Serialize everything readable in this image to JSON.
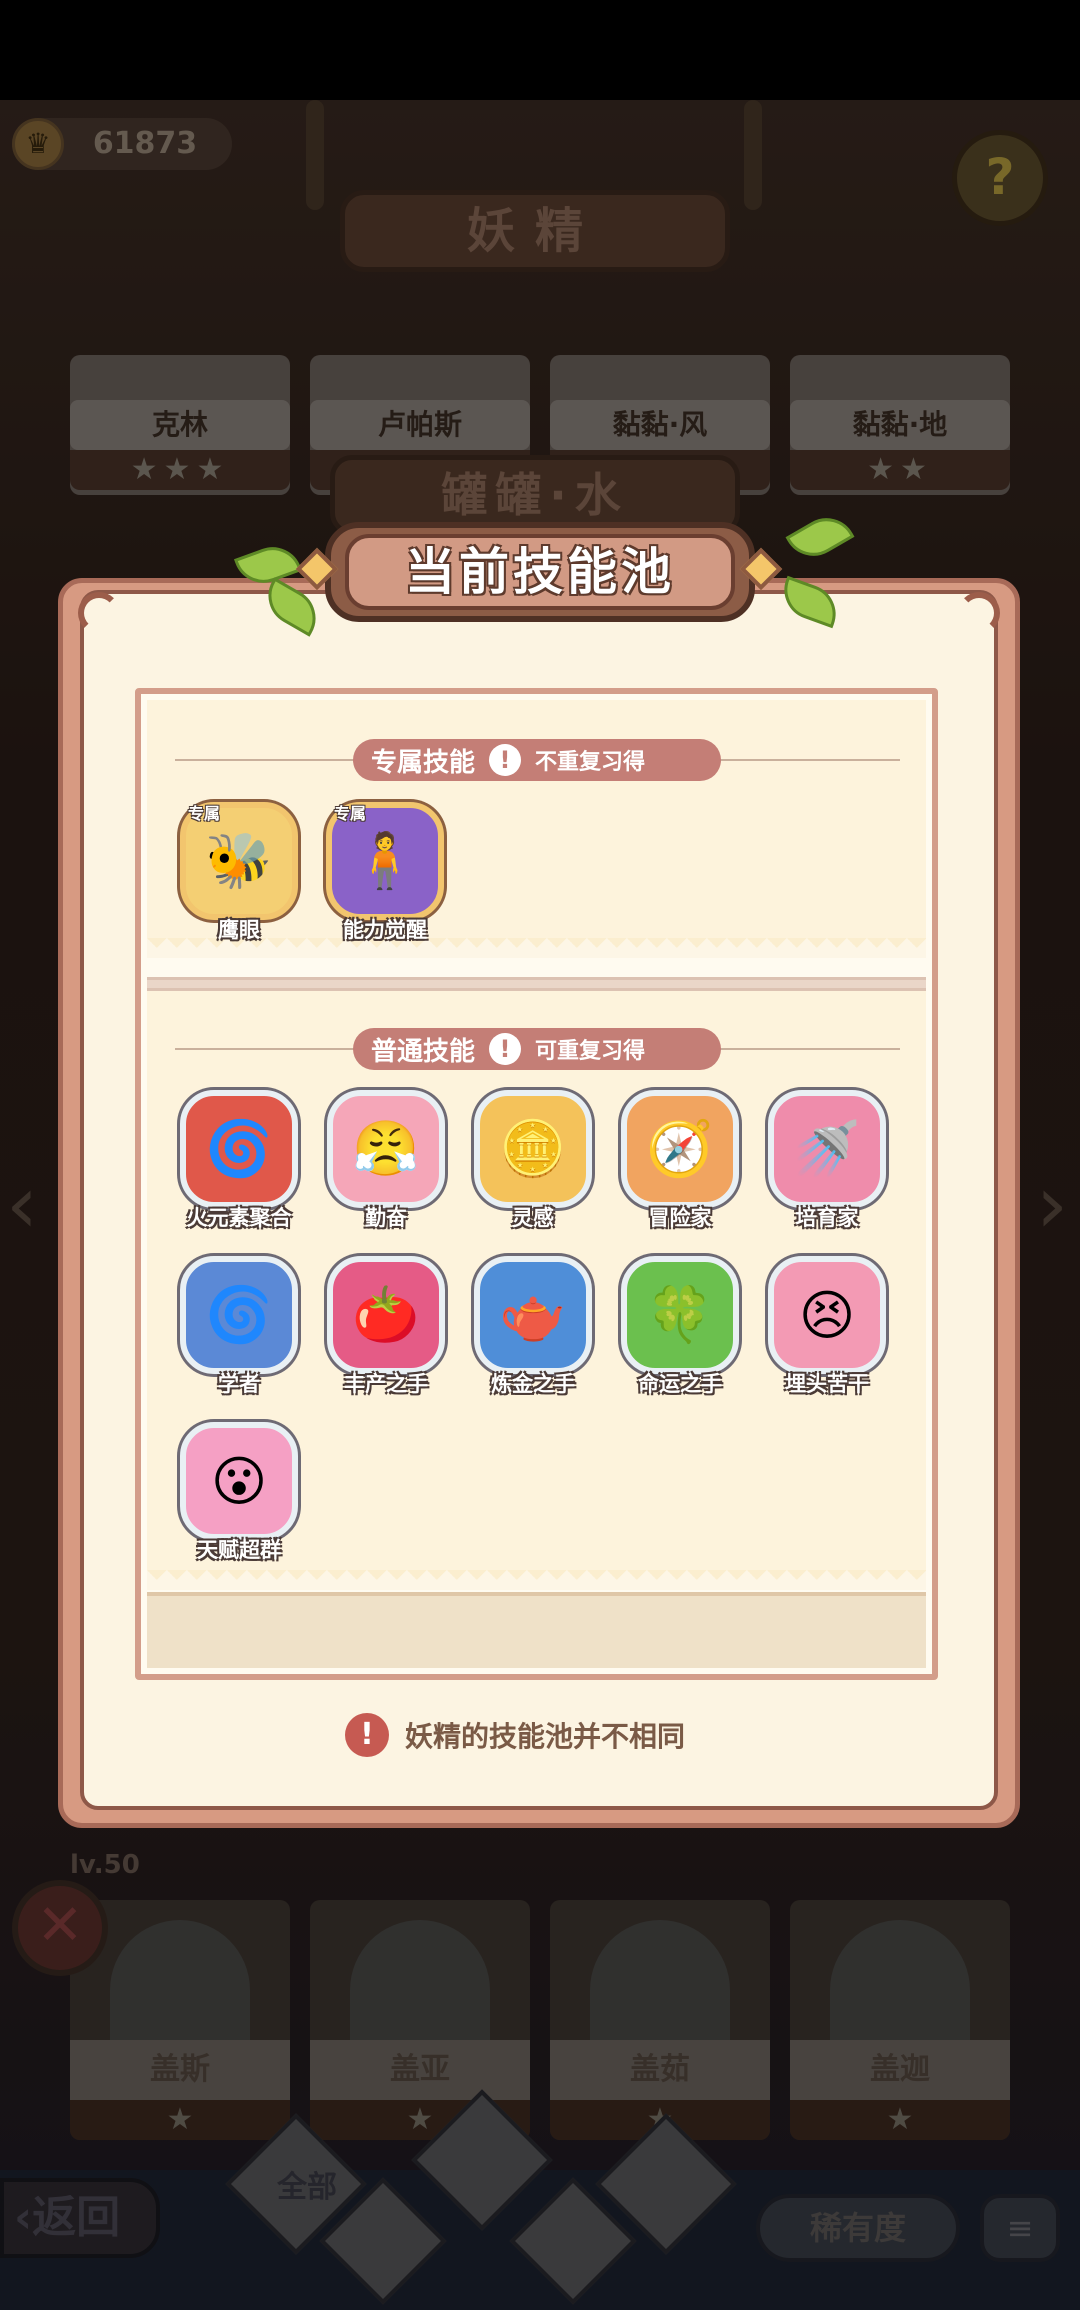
{
  "hud": {
    "coins": "61873",
    "help_icon": "?"
  },
  "header": {
    "title": "妖精"
  },
  "top_row": [
    {
      "name": "克林",
      "stars": "★★★"
    },
    {
      "name": "卢帕斯",
      "stars": ""
    },
    {
      "name": "黏黏·风",
      "stars": ""
    },
    {
      "name": "黏黏·地",
      "stars": "★★"
    }
  ],
  "subheader": "罐罐·水",
  "modal": {
    "title": "当前技能池",
    "exclusive": {
      "label": "专属技能",
      "note": "不重复习得",
      "tag": "专属",
      "skills": [
        {
          "name": "鹰眼",
          "icon": "🐝",
          "bg": "#f4cf73"
        },
        {
          "name": "能力觉醒",
          "icon": "🧍",
          "bg": "#8a62c8"
        }
      ]
    },
    "common": {
      "label": "普通技能",
      "note": "可重复习得",
      "skills": [
        {
          "name": "火元素聚合",
          "icon": "🌀",
          "bg": "#e0584a"
        },
        {
          "name": "勤奋",
          "icon": "😤",
          "bg": "#f5a6b8"
        },
        {
          "name": "灵感",
          "icon": "🪙",
          "bg": "#f4c25a"
        },
        {
          "name": "冒险家",
          "icon": "🧭",
          "bg": "#f1a460"
        },
        {
          "name": "培育家",
          "icon": "🚿",
          "bg": "#ef8cab"
        },
        {
          "name": "学者",
          "icon": "🌀",
          "bg": "#5b89d6"
        },
        {
          "name": "丰产之手",
          "icon": "🍅",
          "bg": "#e55b86"
        },
        {
          "name": "炼金之手",
          "icon": "🫖",
          "bg": "#4f8ed8"
        },
        {
          "name": "命运之手",
          "icon": "🍀",
          "bg": "#6bc04e"
        },
        {
          "name": "埋头苦干",
          "icon": "😣",
          "bg": "#f39ab4"
        },
        {
          "name": "天赋超群",
          "icon": "😮",
          "bg": "#f5a0c4"
        }
      ]
    },
    "notice": "妖精的技能池并不相同",
    "notice_icon": "!"
  },
  "bottom_row": [
    {
      "name": "盖斯",
      "stars": "★"
    },
    {
      "name": "盖亚",
      "stars": "★"
    },
    {
      "name": "盖茹",
      "stars": "★"
    },
    {
      "name": "盖迦",
      "stars": "★"
    }
  ],
  "level_text": "lv.50",
  "close_icon": "✕",
  "footer": {
    "back": "返回",
    "filter_all": "全部",
    "rarity": "稀有度",
    "sort_icon": "≡"
  }
}
